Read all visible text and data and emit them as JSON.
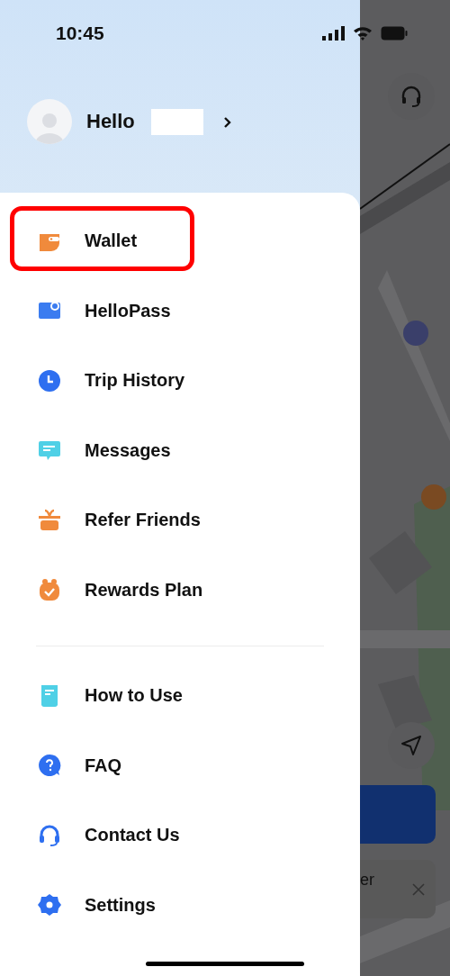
{
  "status_bar": {
    "time": "10:45"
  },
  "profile": {
    "greeting": "Hello",
    "name_hidden": true
  },
  "menu_groups": [
    {
      "items": [
        {
          "label": "Wallet",
          "highlighted": true
        },
        {
          "label": "HelloPass",
          "highlighted": false
        },
        {
          "label": "Trip History",
          "highlighted": false
        },
        {
          "label": "Messages",
          "highlighted": false
        },
        {
          "label": "Refer Friends",
          "highlighted": false
        },
        {
          "label": "Rewards Plan",
          "highlighted": false
        }
      ]
    },
    {
      "items": [
        {
          "label": "How to Use",
          "highlighted": false
        },
        {
          "label": "FAQ",
          "highlighted": false
        },
        {
          "label": "Contact Us",
          "highlighted": false
        },
        {
          "label": "Settings",
          "highlighted": false
        }
      ]
    }
  ],
  "map": {
    "card_text": "er"
  }
}
